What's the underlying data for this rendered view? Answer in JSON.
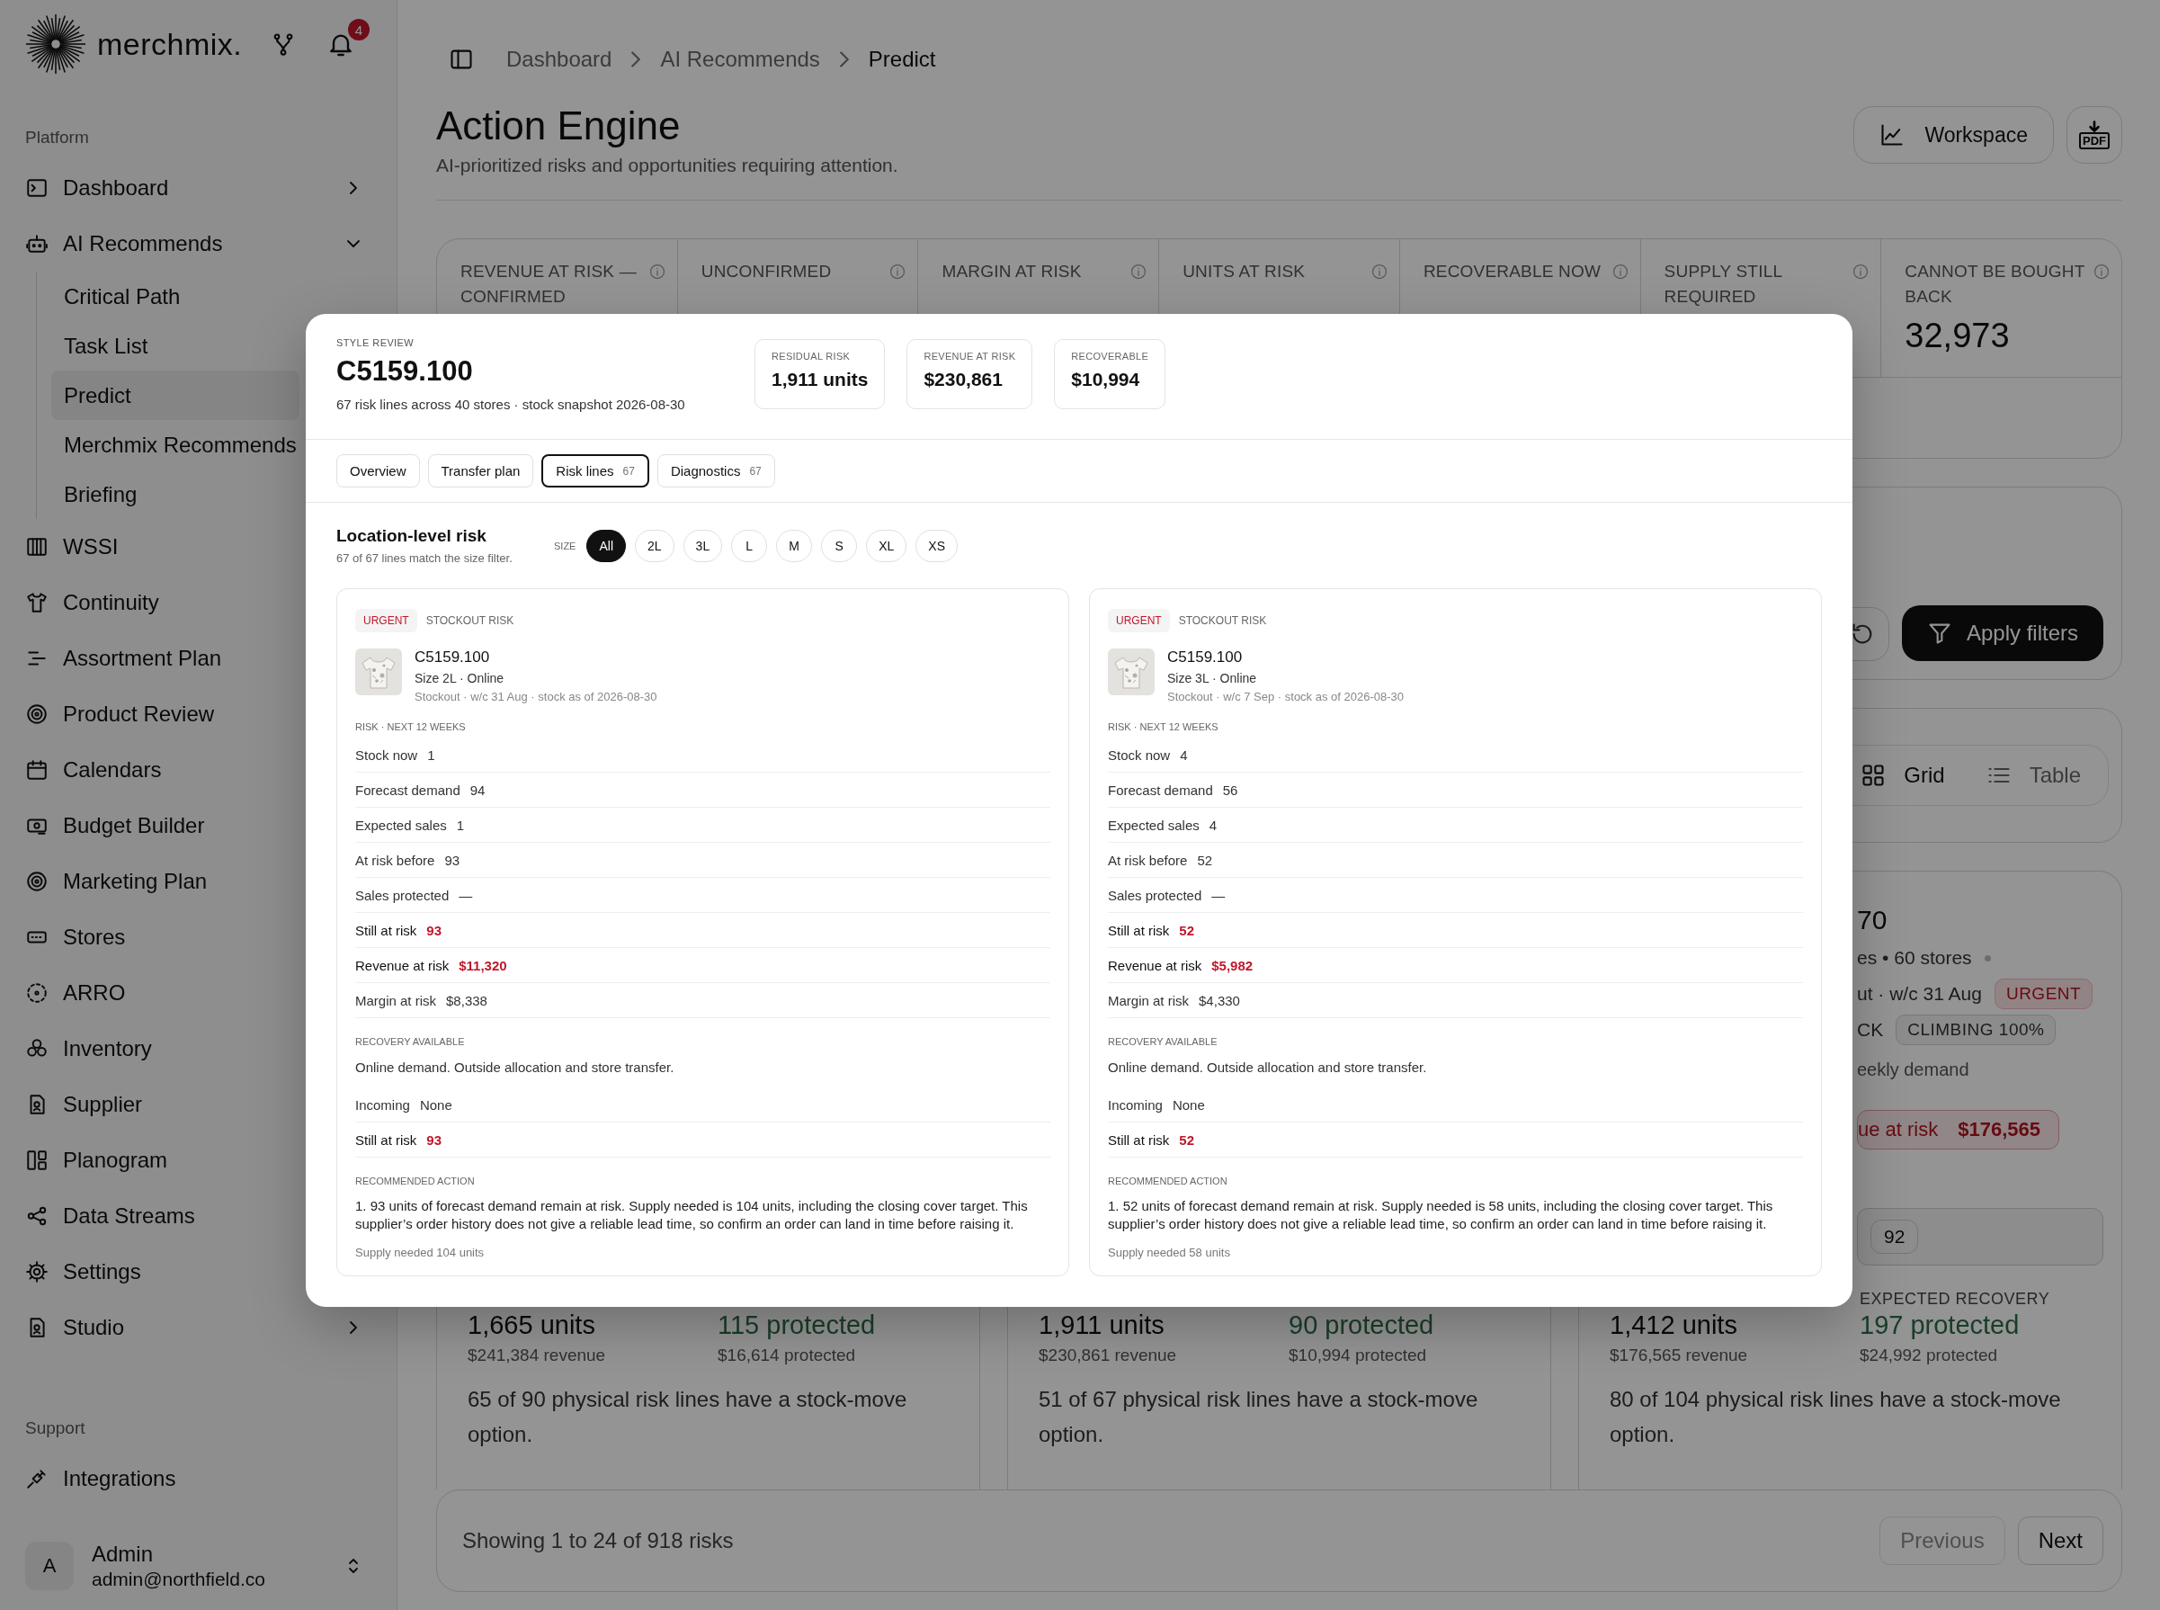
{
  "sidebar": {
    "brand": "merchmix.",
    "notifications": "4",
    "sections": [
      {
        "title": "Platform",
        "items": [
          {
            "label": "Dashboard",
            "expanded": false
          },
          {
            "label": "AI Recommends",
            "expanded": true,
            "children": [
              {
                "label": "Critical Path",
                "selected": false
              },
              {
                "label": "Task List",
                "selected": false
              },
              {
                "label": "Predict",
                "selected": true
              },
              {
                "label": "Merchmix Recommends",
                "selected": false
              },
              {
                "label": "Briefing",
                "selected": false
              }
            ]
          },
          {
            "label": "WSSI"
          },
          {
            "label": "Continuity"
          },
          {
            "label": "Assortment Plan"
          },
          {
            "label": "Product Review"
          },
          {
            "label": "Calendars"
          },
          {
            "label": "Budget Builder"
          },
          {
            "label": "Marketing Plan"
          },
          {
            "label": "Stores"
          },
          {
            "label": "ARRO"
          },
          {
            "label": "Inventory"
          },
          {
            "label": "Supplier"
          },
          {
            "label": "Planogram"
          },
          {
            "label": "Data Streams"
          },
          {
            "label": "Settings"
          },
          {
            "label": "Studio",
            "expanded": false
          }
        ]
      },
      {
        "title": "Support",
        "items": [
          {
            "label": "Integrations"
          }
        ]
      }
    ],
    "user": {
      "initial": "A",
      "name": "Admin",
      "email": "admin@northfield.co"
    }
  },
  "breadcrumb": [
    {
      "label": "Dashboard",
      "current": false
    },
    {
      "label": "AI Recommends",
      "current": false
    },
    {
      "label": "Predict",
      "current": true
    }
  ],
  "header": {
    "title": "Action Engine",
    "subtitle": "AI-prioritized risks and opportunities requiring attention.",
    "workspace": "Workspace",
    "export": "PDF"
  },
  "stats": [
    {
      "label": "REVENUE AT RISK — CONFIRMED"
    },
    {
      "label": "UNCONFIRMED"
    },
    {
      "label": "MARGIN AT RISK"
    },
    {
      "label": "UNITS AT RISK"
    },
    {
      "label": "RECOVERABLE NOW"
    },
    {
      "label": "SUPPLY STILL REQUIRED"
    },
    {
      "label": "CANNOT BE BOUGHT BACK",
      "value": "32,973",
      "alert": false
    }
  ],
  "filters": {
    "apply": "Apply filters"
  },
  "view_toggle": [
    {
      "label": "Grid",
      "selected": true
    },
    {
      "label": "Table",
      "selected": false
    }
  ],
  "summaries": [
    {
      "units": "1,665 units",
      "revenue": "$241,384 revenue",
      "protected": "115 protected",
      "protected_value": "$16,614 protected",
      "note": "65 of 90 physical risk lines have a stock-move option."
    },
    {
      "units": "1,911 units",
      "revenue": "$230,861 revenue",
      "protected": "90 protected",
      "protected_value": "$10,994 protected",
      "note": "51 of 67 physical risk lines have a stock-move option."
    },
    {
      "recovery_label": "EXPECTED RECOVERY",
      "units": "1,412 units",
      "revenue": "$176,565 revenue",
      "protected": "197 protected",
      "protected_value": "$24,992 protected",
      "note": "80 of 104 physical risk lines have a stock-move option.",
      "peek": [
        {
          "kind": "heading",
          "text": "70"
        },
        {
          "kind": "meta",
          "text": "es • 60 stores"
        },
        {
          "kind": "meta",
          "text": "ut · w/c 31 Aug",
          "badge": {
            "text": "URGENT",
            "alert": true
          }
        },
        {
          "kind": "meta",
          "text": "CK",
          "badge": {
            "text": "CLIMBING 100%",
            "alert": false
          }
        },
        {
          "kind": "muted",
          "text": "eekly demand"
        },
        {
          "kind": "alert-pill",
          "text": "ue at risk",
          "value": "$176,565"
        },
        {
          "kind": "count-pill",
          "text": "92"
        }
      ]
    }
  ],
  "pagination": {
    "summary": "Showing 1 to 24 of 918 risks",
    "buttons": [
      {
        "label": "Previous",
        "disabled": true
      },
      {
        "label": "Next",
        "disabled": false
      }
    ]
  },
  "modal": {
    "eyebrow": "STYLE REVIEW",
    "title": "C5159.100",
    "subtitle": "67 risk lines across 40 stores · stock snapshot 2026-08-30",
    "stats": [
      {
        "label": "RESIDUAL RISK",
        "value": "1,911 units"
      },
      {
        "label": "REVENUE AT RISK",
        "value": "$230,861"
      },
      {
        "label": "RECOVERABLE",
        "value": "$10,994"
      }
    ],
    "tabs": [
      {
        "label": "Overview",
        "selected": false
      },
      {
        "label": "Transfer plan",
        "selected": false
      },
      {
        "label": "Risk lines",
        "count": "67",
        "selected": true
      },
      {
        "label": "Diagnostics",
        "count": "67",
        "selected": false
      }
    ],
    "section_title": "Location-level risk",
    "section_subtitle": "67 of 67 lines match the size filter.",
    "size_label": "SIZE",
    "sizes": [
      {
        "label": "All",
        "selected": true
      },
      {
        "label": "2L",
        "selected": false
      },
      {
        "label": "3L",
        "selected": false
      },
      {
        "label": "L",
        "selected": false
      },
      {
        "label": "M",
        "selected": false
      },
      {
        "label": "S",
        "selected": false
      },
      {
        "label": "XL",
        "selected": false
      },
      {
        "label": "XS",
        "selected": false
      }
    ],
    "cards": [
      {
        "tag": "URGENT",
        "category": "STOCKOUT RISK",
        "style": "C5159.100",
        "variant": "Size 2L · Online",
        "note": "Stockout · w/c 31 Aug · stock as of 2026-08-30",
        "metrics_title": "RISK · NEXT 12 WEEKS",
        "metrics": [
          {
            "label": "Stock now",
            "value": "1",
            "alert": false
          },
          {
            "label": "Forecast demand",
            "value": "94",
            "alert": false
          },
          {
            "label": "Expected sales",
            "value": "1",
            "alert": false
          },
          {
            "label": "At risk before",
            "value": "93",
            "alert": false
          },
          {
            "label": "Sales protected",
            "value": "—",
            "alert": false
          },
          {
            "label": "Still at risk",
            "value": "93",
            "alert": true
          },
          {
            "label": "Revenue at risk",
            "value": "$11,320",
            "alert": true
          },
          {
            "label": "Margin at risk",
            "value": "$8,338",
            "alert": false
          }
        ],
        "recovery_title": "RECOVERY AVAILABLE",
        "recovery": "Online demand. Outside allocation and store transfer.",
        "supply": [
          {
            "label": "Incoming",
            "value": "None",
            "alert": false
          },
          {
            "label": "Still at risk",
            "value": "93",
            "alert": true
          }
        ],
        "action_title": "RECOMMENDED ACTION",
        "action": "1. 93 units of forecast demand remain at risk. Supply needed is 104 units, including the closing cover target. This supplier’s order history does not give a reliable lead time, so confirm an order can land in time before raising it.",
        "footnote": "Supply needed 104 units"
      },
      {
        "tag": "URGENT",
        "category": "STOCKOUT RISK",
        "style": "C5159.100",
        "variant": "Size 3L · Online",
        "note": "Stockout · w/c 7 Sep · stock as of 2026-08-30",
        "metrics_title": "RISK · NEXT 12 WEEKS",
        "metrics": [
          {
            "label": "Stock now",
            "value": "4",
            "alert": false
          },
          {
            "label": "Forecast demand",
            "value": "56",
            "alert": false
          },
          {
            "label": "Expected sales",
            "value": "4",
            "alert": false
          },
          {
            "label": "At risk before",
            "value": "52",
            "alert": false
          },
          {
            "label": "Sales protected",
            "value": "—",
            "alert": false
          },
          {
            "label": "Still at risk",
            "value": "52",
            "alert": true
          },
          {
            "label": "Revenue at risk",
            "value": "$5,982",
            "alert": true
          },
          {
            "label": "Margin at risk",
            "value": "$4,330",
            "alert": false
          }
        ],
        "recovery_title": "RECOVERY AVAILABLE",
        "recovery": "Online demand. Outside allocation and store transfer.",
        "supply": [
          {
            "label": "Incoming",
            "value": "None",
            "alert": false
          },
          {
            "label": "Still at risk",
            "value": "52",
            "alert": true
          }
        ],
        "action_title": "RECOMMENDED ACTION",
        "action": "1. 52 units of forecast demand remain at risk. Supply needed is 58 units, including the closing cover target. This supplier’s order history does not give a reliable lead time, so confirm an order can land in time before raising it.",
        "footnote": "Supply needed 58 units"
      }
    ]
  }
}
